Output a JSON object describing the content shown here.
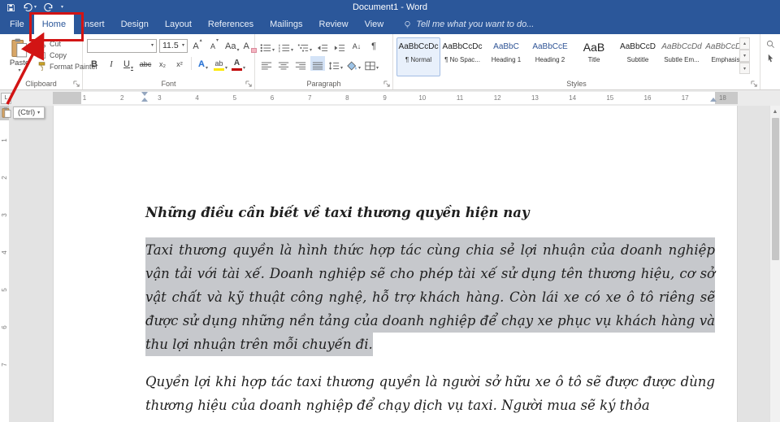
{
  "titlebar": {
    "title": "Document1 - Word"
  },
  "tabs": {
    "file": "File",
    "home": "Home",
    "insert": "Insert",
    "design": "Design",
    "layout": "Layout",
    "references": "References",
    "mailings": "Mailings",
    "review": "Review",
    "view": "View",
    "tell_me": "Tell me what you want to do..."
  },
  "icons": {
    "caret": "▾",
    "caret_up": "▴",
    "pilcrow": "¶",
    "tab_stop": "L",
    "scroll_up": "▲"
  },
  "ribbon": {
    "clipboard": {
      "label": "Clipboard",
      "paste": "Paste",
      "cut": "Cut",
      "copy": "Copy",
      "format_painter": "Format Painter"
    },
    "font": {
      "label": "Font",
      "font_name_value": "",
      "font_size_value": "11.5",
      "bold": "B",
      "italic": "I",
      "underline": "U",
      "strikethrough": "abc",
      "subscript": "x₂",
      "superscript": "x²",
      "grow_font": "A",
      "shrink_font": "A",
      "change_case": "Aa",
      "clear_formatting": "A",
      "text_effects": "A",
      "highlight": "ab",
      "font_color": "A"
    },
    "paragraph": {
      "label": "Paragraph",
      "sort": "A↓"
    },
    "styles": {
      "label": "Styles",
      "items": [
        {
          "preview": "AaBbCcDc",
          "name": "¶ Normal"
        },
        {
          "preview": "AaBbCcDc",
          "name": "¶ No Spac..."
        },
        {
          "preview": "AaBbC",
          "name": "Heading 1"
        },
        {
          "preview": "AaBbCcE",
          "name": "Heading 2"
        },
        {
          "preview": "AaB",
          "name": "Title"
        },
        {
          "preview": "AaBbCcD",
          "name": "Subtitle"
        },
        {
          "preview": "AaBbCcDd",
          "name": "Subtle Em..."
        },
        {
          "preview": "AaBbCcDd",
          "name": "Emphasis"
        }
      ]
    }
  },
  "ruler": {
    "h_numbers": [
      "1",
      "2",
      "3",
      "4",
      "5",
      "6",
      "7",
      "8",
      "9",
      "10",
      "11",
      "12",
      "13",
      "14",
      "15",
      "16",
      "17",
      "18"
    ],
    "v_numbers": [
      "1",
      "2",
      "3",
      "4",
      "5",
      "6",
      "7"
    ]
  },
  "popup": {
    "ctrl_label": "(Ctrl)"
  },
  "document": {
    "heading": "Những điều cần biết về taxi thương quyền hiện nay",
    "selected_paragraph": "Taxi thương quyền là hình thức hợp tác cùng chia sẻ lợi nhuận của doanh nghiệp vận tải với tài xế. Doanh nghiệp sẽ cho phép tài xế sử dụng tên thương hiệu, cơ sở vật chất và kỹ thuật công nghệ, hỗ trợ khách hàng. Còn lái xe có xe ô tô riêng sẽ được sử dụng những nền tảng của doanh nghiệp để chạy xe phục vụ khách hàng và thu lợi nhuận trên mỗi chuyến đi.",
    "paragraph_2": "Quyền lợi khi hợp tác taxi thương quyền là người sở hữu xe ô tô sẽ được được dùng thương hiệu của doanh nghiệp để chạy dịch vụ taxi. Người mua sẽ ký thỏa"
  },
  "colors": {
    "titlebar": "#2b579a",
    "annotation": "#d21414",
    "selection": "#c6c8cc",
    "highlight_bar": "#fce800",
    "font_color_bar": "#c00000"
  }
}
